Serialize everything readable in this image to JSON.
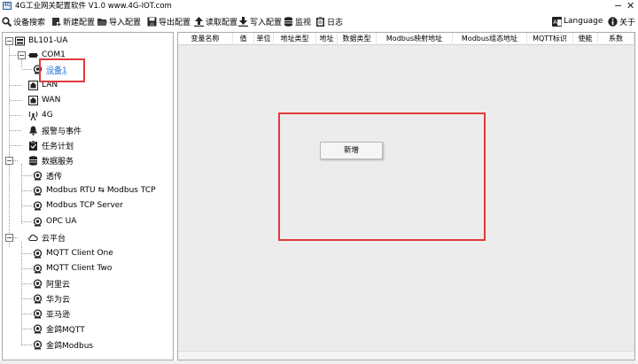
{
  "window": {
    "title": "4G工业网关配置软件 V1.0 www.4G-IOT.com",
    "icon_label": "4G",
    "minimize": "−",
    "close": "✕"
  },
  "toolbar": {
    "search": "设备搜索",
    "new_config": "新建配置",
    "import_config": "导入配置",
    "export_config": "导出配置",
    "read_config": "读取配置",
    "write_config": "写入配置",
    "monitor": "监视",
    "log": "日志",
    "language": "Language",
    "about": "关于"
  },
  "tree": {
    "root": "BL101-UA",
    "com1": "COM1",
    "device1": "设备1",
    "lan": "LAN",
    "wan": "WAN",
    "g4": "4G",
    "alarm": "报警与事件",
    "task": "任务计划",
    "data_service": "数据服务",
    "passthrough": "透传",
    "rtu_tcp": "Modbus RTU ⇆ Modbus TCP",
    "tcp_server": "Modbus TCP Server",
    "opc_ua": "OPC UA",
    "cloud": "云平台",
    "mqtt_one": "MQTT Client One",
    "mqtt_two": "MQTT Client Two",
    "aliyun": "阿里云",
    "huawei": "华为云",
    "aws": "亚马逊",
    "jinge_mqtt": "金鸽MQTT",
    "jinge_modbus": "金鸽Modbus"
  },
  "grid": {
    "columns": [
      "变量名称",
      "值",
      "单位",
      "地址类型",
      "地址",
      "数据类型",
      "Modbus映射地址",
      "Modbus组态地址",
      "MQTT标识",
      "使能",
      "系数"
    ]
  },
  "context_menu": {
    "add": "新增"
  },
  "colors": {
    "highlight": "#e23a3a",
    "selected_text": "#1a73d9",
    "grid_bg": "#ececec"
  }
}
